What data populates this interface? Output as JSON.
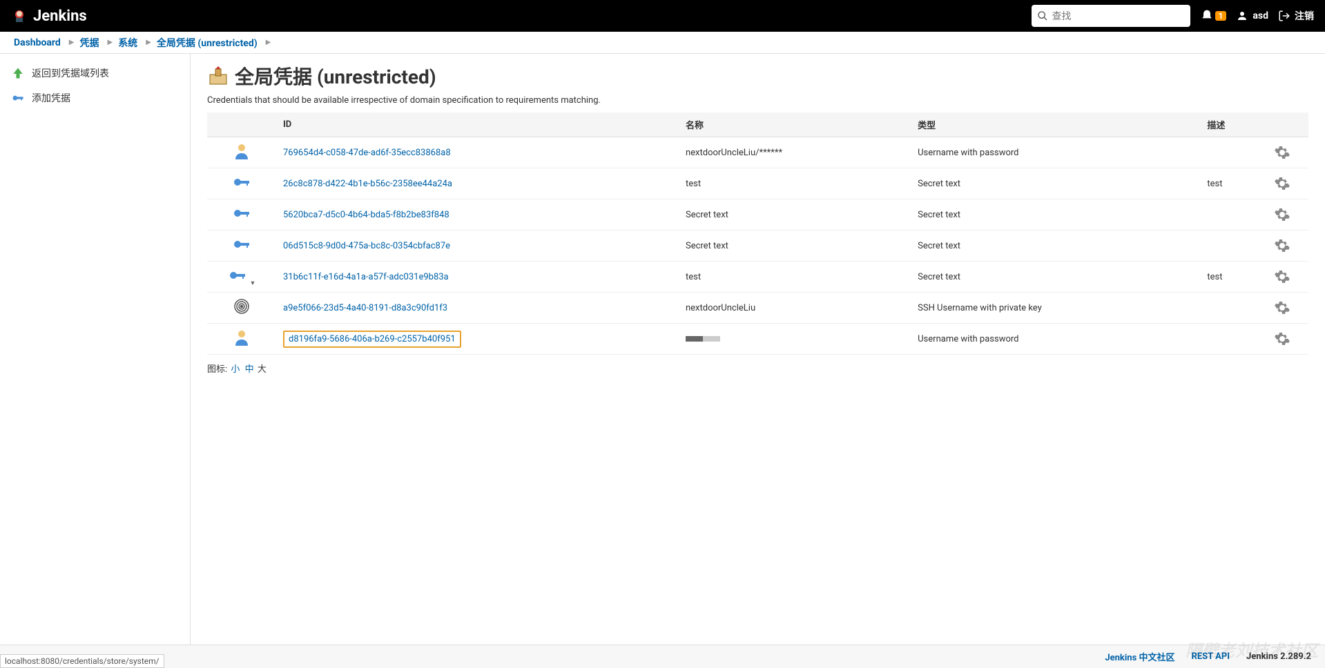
{
  "header": {
    "brand": "Jenkins",
    "search_placeholder": "查找",
    "notif_count": "1",
    "user": "asd",
    "logout": "注销"
  },
  "breadcrumbs": [
    {
      "label": "Dashboard"
    },
    {
      "label": "凭据"
    },
    {
      "label": "系统"
    },
    {
      "label": "全局凭据 (unrestricted)"
    }
  ],
  "sidebar": {
    "back_label": "返回到凭据域列表",
    "add_label": "添加凭据"
  },
  "page": {
    "title": "全局凭据 (unrestricted)",
    "description": "Credentials that should be available irrespective of domain specification to requirements matching."
  },
  "table": {
    "headers": {
      "id": "ID",
      "name": "名称",
      "type": "类型",
      "desc": "描述"
    },
    "rows": [
      {
        "icon": "userpass",
        "id": "769654d4-c058-47de-ad6f-35ecc83868a8",
        "name": "nextdoorUncleLiu/******",
        "type": "Username with password",
        "desc": "",
        "highlighted": false,
        "caret": false
      },
      {
        "icon": "key",
        "id": "26c8c878-d422-4b1e-b56c-2358ee44a24a",
        "name": "test",
        "type": "Secret text",
        "desc": "test",
        "highlighted": false,
        "caret": false
      },
      {
        "icon": "key",
        "id": "5620bca7-d5c0-4b64-bda5-f8b2be83f848",
        "name": "Secret text",
        "type": "Secret text",
        "desc": "",
        "highlighted": false,
        "caret": false
      },
      {
        "icon": "key",
        "id": "06d515c8-9d0d-475a-bc8c-0354cbfac87e",
        "name": "Secret text",
        "type": "Secret text",
        "desc": "",
        "highlighted": false,
        "caret": false
      },
      {
        "icon": "key",
        "id": "31b6c11f-e16d-4a1a-a57f-adc031e9b83a",
        "name": "test",
        "type": "Secret text",
        "desc": "test",
        "highlighted": false,
        "caret": true
      },
      {
        "icon": "fingerprint",
        "id": "a9e5f066-23d5-4a40-8191-d8a3c90fd1f3",
        "name": "nextdoorUncleLiu",
        "type": "SSH Username with private key",
        "desc": "",
        "highlighted": false,
        "caret": false
      },
      {
        "icon": "userpass",
        "id": "d8196fa9-5686-406a-b269-c2557b40f951",
        "name": "__MASKED__",
        "type": "Username with password",
        "desc": "",
        "highlighted": true,
        "caret": false
      }
    ]
  },
  "icon_size": {
    "label": "图标:",
    "small": "小",
    "medium": "中",
    "large": "大"
  },
  "footer": {
    "community": "Jenkins 中文社区",
    "rest_api": "REST API",
    "version": "Jenkins 2.289.2"
  },
  "status_url": "localhost:8080/credentials/store/system/",
  "watermark": "隔壁老刘技术社区"
}
